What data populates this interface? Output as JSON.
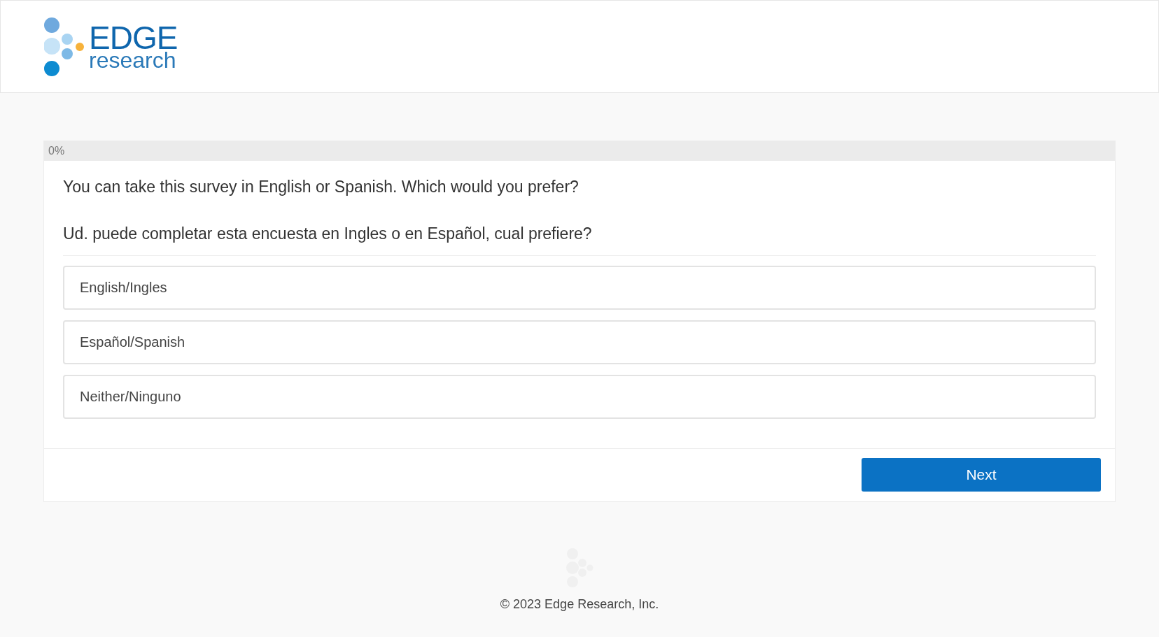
{
  "header": {
    "logo": {
      "title": "EDGE",
      "subtitle": "research"
    }
  },
  "progress": {
    "label": "0%",
    "level": 0
  },
  "question": {
    "lines": [
      "You can take this survey in English or Spanish. Which would you prefer?",
      "Ud. puede completar esta encuesta en Ingles o en Español, cual prefiere?"
    ],
    "options": [
      {
        "label": "English/Ingles",
        "selected": false
      },
      {
        "label": "Español/Spanish",
        "selected": false
      },
      {
        "label": "Neither/Ninguno",
        "selected": false
      }
    ]
  },
  "buttons": [
    "Next"
  ],
  "footer": {
    "copyright": "© 2023 Edge Research, Inc."
  }
}
